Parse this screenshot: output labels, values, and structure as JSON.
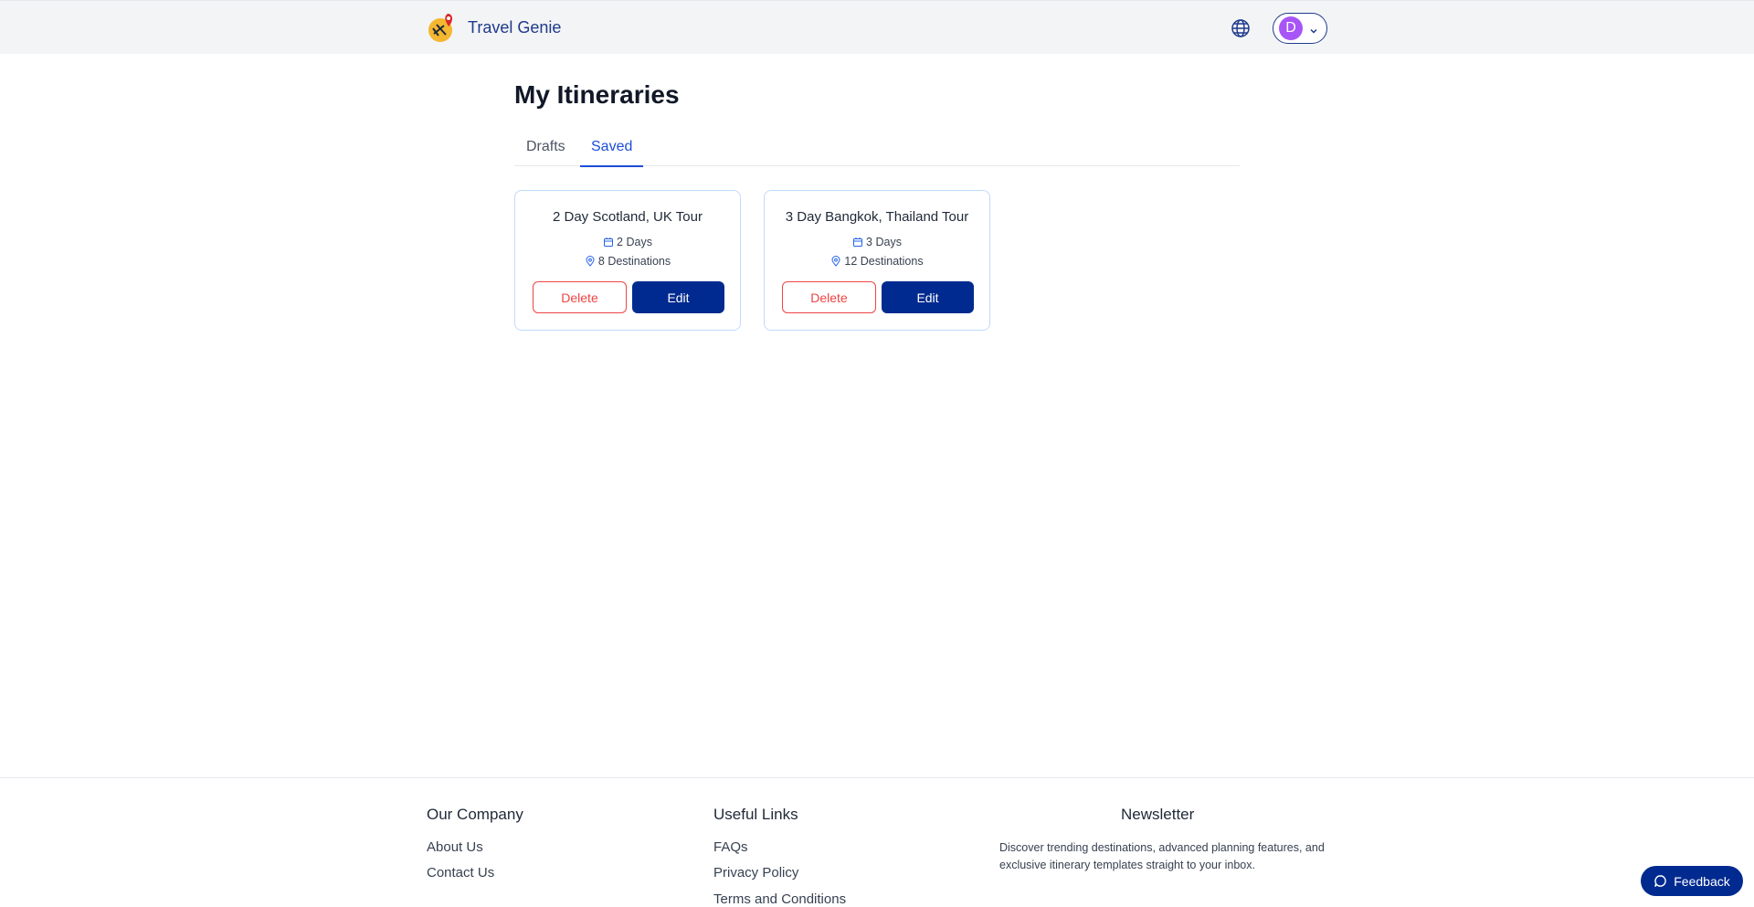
{
  "header": {
    "brand_name": "Travel Genie",
    "user_initial": "D",
    "icons": [
      "logo-icon",
      "globe-icon",
      "chevron-down-icon"
    ]
  },
  "page": {
    "title": "My Itineraries",
    "tabs": [
      {
        "label": "Drafts",
        "active": false
      },
      {
        "label": "Saved",
        "active": true
      }
    ]
  },
  "itineraries": [
    {
      "title": "2 Day Scotland, UK Tour",
      "days": "2 Days",
      "destinations": "8 Destinations",
      "delete_label": "Delete",
      "edit_label": "Edit"
    },
    {
      "title": "3 Day Bangkok, Thailand Tour",
      "days": "3 Days",
      "destinations": "12 Destinations",
      "delete_label": "Delete",
      "edit_label": "Edit"
    }
  ],
  "footer": {
    "company": {
      "heading": "Our Company",
      "links": [
        "About Us",
        "Contact Us"
      ]
    },
    "useful": {
      "heading": "Useful Links",
      "links": [
        "FAQs",
        "Privacy Policy",
        "Terms and Conditions"
      ]
    },
    "newsletter": {
      "heading": "Newsletter",
      "text": "Discover trending destinations, advanced planning features, and exclusive itinerary templates straight to your inbox."
    }
  },
  "feedback_label": "Feedback",
  "colors": {
    "accent": "#002a8f",
    "danger": "#ef4444",
    "link": "#1d4ed8",
    "avatar": "#a855f7"
  }
}
